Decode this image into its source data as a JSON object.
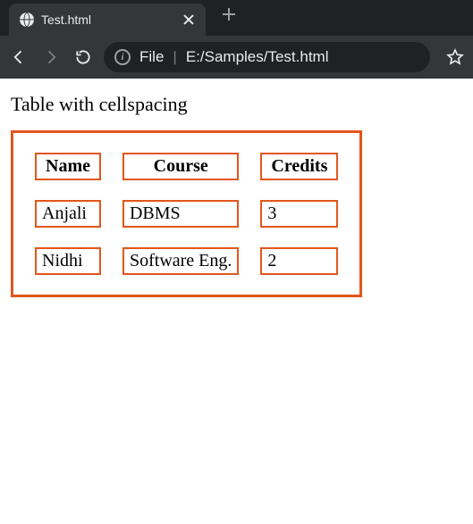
{
  "browser": {
    "tab_title": "Test.html",
    "url_scheme": "File",
    "url_path": "E:/Samples/Test.html"
  },
  "page": {
    "heading": "Table with cellspacing",
    "table": {
      "headers": [
        "Name",
        "Course",
        "Credits"
      ],
      "rows": [
        [
          "Anjali",
          "DBMS",
          "3"
        ],
        [
          "Nidhi",
          "Software Eng.",
          "2"
        ]
      ]
    }
  }
}
